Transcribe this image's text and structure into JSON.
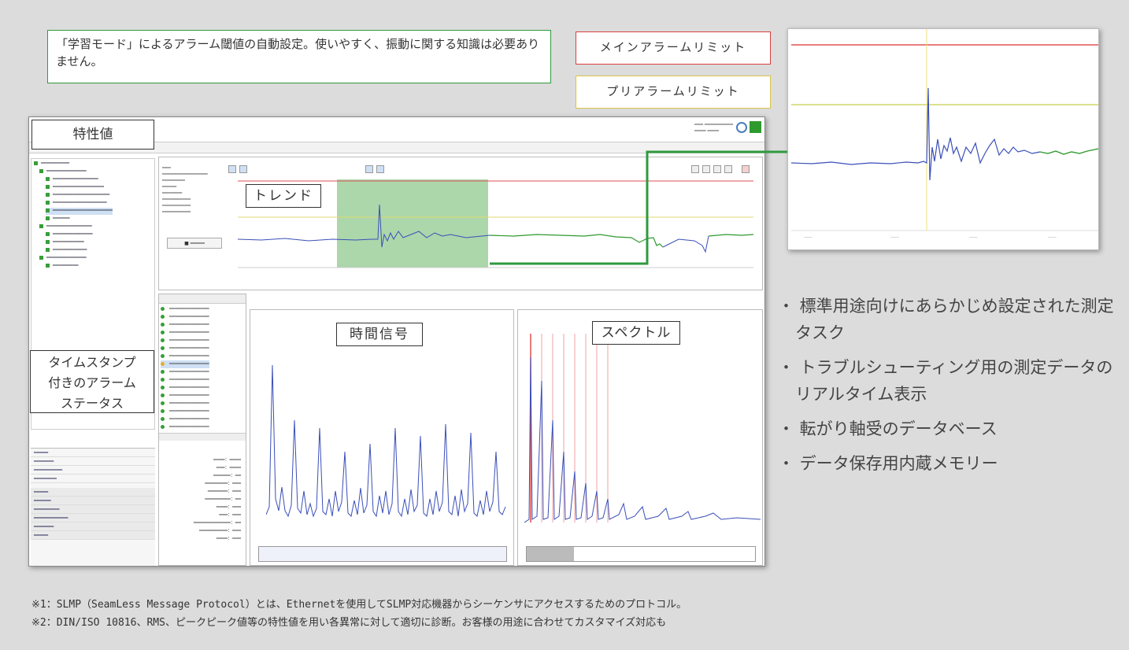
{
  "callout_learning": "「学習モード」によるアラーム閾値の自動設定。使いやすく、振動に関する知識は必要ありません。",
  "legend_main_alarm": "メインアラームリミット",
  "legend_pre_alarm": "プリアラームリミット",
  "label_characteristic": "特性値",
  "label_trend": "トレンド",
  "label_time_signal": "時間信号",
  "label_spectrum": "スペクトル",
  "label_alarm_status": "タイムスタンプ付きのアラームステータス",
  "bullets": [
    "・ 標準用途向けにあらかじめ設定された測定タスク",
    "・ トラブルシューティング用の測定データのリアルタイム表示",
    "・ 転がり軸受のデータベース",
    "・ データ保存用内蔵メモリー"
  ],
  "footnotes": [
    "※1：SLMP（SeamLess Message Protocol）とは、Ethernetを使用してSLMP対応機器からシーケンサにアクセスするためのプロトコル。",
    "※2：DIN/ISO 10816、RMS、ピークピーク値等の特性値を用い各異常に対して適切に診断。お客様の用途に合わせてカスタマイズ対応も"
  ],
  "colors": {
    "main_alarm": "#e05050",
    "pre_alarm": "#d9c34a",
    "trend_blue": "#3b4fb8",
    "trend_green": "#2e9a2e",
    "highlight": "#2f9a3f"
  }
}
